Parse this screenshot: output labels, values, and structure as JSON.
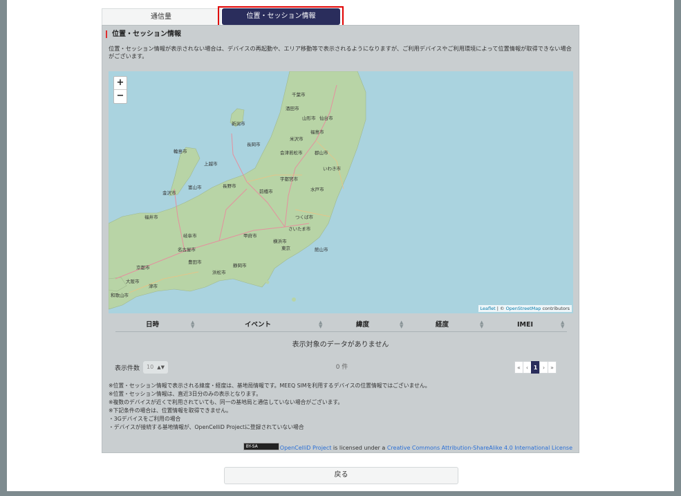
{
  "tabs": [
    {
      "label": "通信量",
      "active": false
    },
    {
      "label": "位置・セッション情報",
      "active": true
    }
  ],
  "section": {
    "title": "位置・セッション情報",
    "description": "位置・セッション情報が表示されない場合は、デバイスの再起動や、エリア移動等で表示されるようになりますが、ご利用デバイスやご利用環境によって位置情報が取得できない場合がございます。"
  },
  "map": {
    "zoom_in": "+",
    "zoom_out": "−",
    "attribution": {
      "leaflet": "Leaflet",
      "separator": " | © ",
      "osm": "OpenStreetMap",
      "suffix": " contributors"
    },
    "cities": [
      "新潟市",
      "山形市",
      "仙台市",
      "福島市",
      "郡山市",
      "長野市",
      "前橋市",
      "宇都宮市",
      "水戸市",
      "つくば市",
      "さいたま市",
      "千葉市",
      "東京",
      "横浜市",
      "甲府市",
      "静岡市",
      "浜松市",
      "名古屋市",
      "岐阜市",
      "福井市",
      "金沢市",
      "富山市",
      "京都市",
      "大阪市",
      "和歌山市",
      "津市",
      "豊田市",
      "いわき市",
      "長岡市",
      "上越市",
      "酒田市",
      "米沢市",
      "会津若松市",
      "輪島市",
      "館山市"
    ]
  },
  "table": {
    "columns": [
      "日時",
      "イベント",
      "緯度",
      "経度",
      "IMEI"
    ],
    "empty_message": "表示対象のデータがありません"
  },
  "pagination": {
    "per_page_label": "表示件数",
    "per_page_value": "10",
    "count": "0 件",
    "first": "«",
    "prev": "‹",
    "current": "1",
    "next": "›",
    "last": "»"
  },
  "notes": [
    "※位置・セッション情報で表示される緯度・経度は、基地局情報です。MEEQ SIMを利用するデバイスの位置情報ではございません。",
    "※位置・セッション情報は、直近3日分のみの表示となります。",
    "※複数のデバイスが近くで利用されていても、同一の基地局と通信していない場合がございます。",
    "※下記条件の場合は、位置情報を取得できません。",
    "・3Gデバイスをご利用の場合",
    "・デバイスが接続する基地情報が、OpenCelliD Projectに登録されていない場合"
  ],
  "license": {
    "badge": "BY-SA",
    "project": "OpenCelliD Project",
    "middle": " is licensed under a ",
    "license_name": "Creative Commons Attribution-ShareAlike 4.0 International License"
  },
  "back_button": "戻る",
  "colors": {
    "accent": "#2a2d5c",
    "highlight_border": "#e00000",
    "panel": "#c9ced0",
    "sea": "#aad3df",
    "land": "#b8d4a6"
  }
}
